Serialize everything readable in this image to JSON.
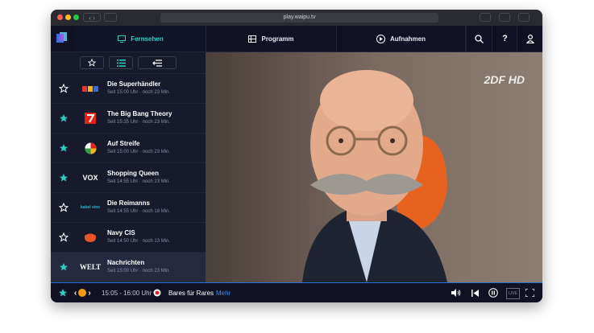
{
  "browser": {
    "url": "play.waipu.tv"
  },
  "nav": {
    "tabs": [
      {
        "label": "Fernsehen",
        "active": true,
        "icon": "tv-icon"
      },
      {
        "label": "Programm",
        "active": false,
        "icon": "grid-icon"
      },
      {
        "label": "Aufnahmen",
        "active": false,
        "icon": "play-circle-icon"
      }
    ],
    "icons": [
      "search-icon",
      "help-icon",
      "user-icon"
    ],
    "help_glyph": "?"
  },
  "channels": [
    {
      "name": "Die Superhändler",
      "time": "Seit 15:00 Uhr · noch 23 Min.",
      "favorite": false,
      "logo": "RTL"
    },
    {
      "name": "The Big Bang Theory",
      "time": "Seit 15:35 Uhr · noch 23 Min.",
      "favorite": true,
      "logo": "7"
    },
    {
      "name": "Auf Streife",
      "time": "Seit 15:00 Uhr · noch 23 Min.",
      "favorite": true,
      "logo": "sat1"
    },
    {
      "name": "Shopping Queen",
      "time": "Seit 14:55 Uhr · noch 23 Min.",
      "favorite": true,
      "logo": "VOX"
    },
    {
      "name": "Die Reimanns",
      "time": "Seit 14:55 Uhr · noch 18 Min.",
      "favorite": false,
      "logo": "kabel eins"
    },
    {
      "name": "Navy CIS",
      "time": "Seit 14:50 Uhr · noch 13 Min.",
      "favorite": false,
      "logo": "sixx"
    },
    {
      "name": "Nachrichten",
      "time": "Seit 15:00 Uhr · noch 23 Min.",
      "favorite": true,
      "logo": "WELT",
      "selected": true
    }
  ],
  "video": {
    "channel_logo": "2DF HD"
  },
  "player": {
    "time_range": "15:05 - 16:00 Uhr",
    "title": "Bares für Rares",
    "more": "Mehr",
    "live": "LIVE"
  },
  "colors": {
    "accent": "#2ad1c2",
    "bg": "#15172a",
    "link": "#3d8ef0",
    "record": "#e0242c"
  }
}
